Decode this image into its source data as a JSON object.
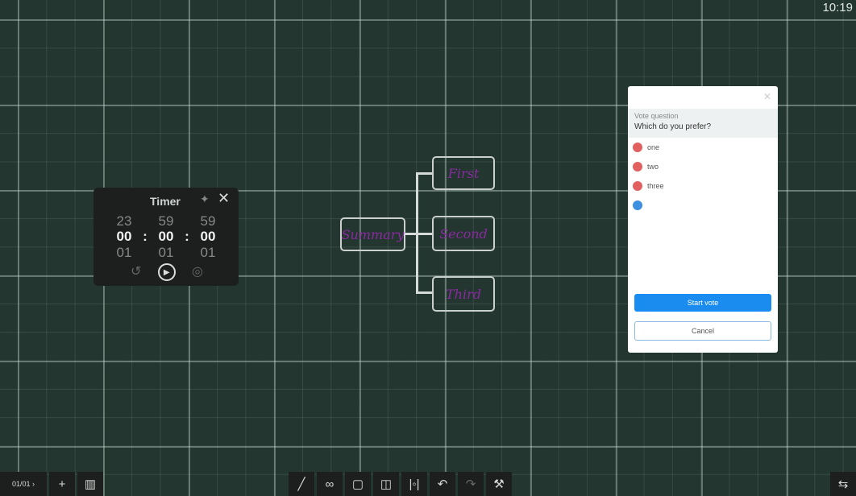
{
  "clock": "10:19",
  "timer": {
    "title": "Timer",
    "above": [
      "23",
      "59",
      "59"
    ],
    "current": [
      "00",
      "00",
      "00"
    ],
    "below": [
      "01",
      "01",
      "01"
    ],
    "sep": ":"
  },
  "mindmap": {
    "root": "Summary",
    "children": [
      "First",
      "Second",
      "Third"
    ],
    "ink_color": "#8a2aa0"
  },
  "vote": {
    "question_label": "Vote question",
    "question": "Which do you prefer?",
    "options": [
      "one",
      "two",
      "three"
    ],
    "start_label": "Start vote",
    "cancel_label": "Cancel",
    "accent": "#1a8cf0"
  },
  "toolbar": {
    "page": "01/01"
  },
  "icons": {
    "pen": "pen-icon",
    "eraser": "eraser-icon",
    "select": "select-icon",
    "shape": "shape-icon",
    "fit": "fit-icon",
    "undo": "undo-icon",
    "redo": "redo-icon",
    "tools": "tools-icon"
  }
}
